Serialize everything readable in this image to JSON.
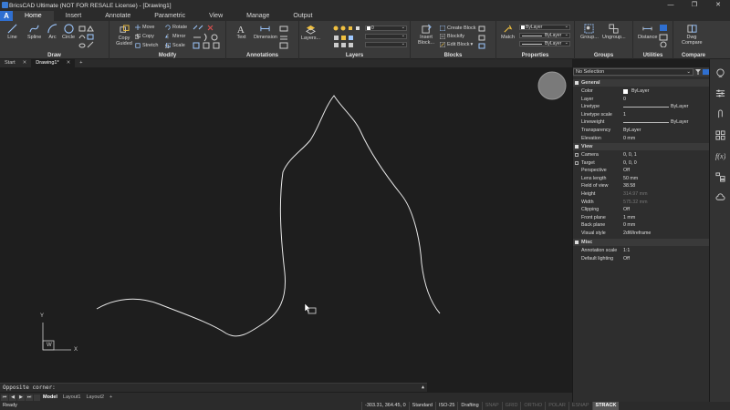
{
  "window": {
    "title": "BricsCAD Ultimate (NOT FOR RESALE License) - [Drawing1]",
    "minimize": "—",
    "restore": "❐",
    "close": "✕"
  },
  "ribbon_tabs": [
    "Home",
    "Insert",
    "Annotate",
    "Parametric",
    "View",
    "Manage",
    "Output"
  ],
  "app_logo": "A",
  "ribbon": {
    "draw": {
      "label": "Draw",
      "tools": [
        "Line",
        "Spline",
        "Arc",
        "Circle"
      ]
    },
    "modify": {
      "label": "Modify",
      "copy_guided": "Copy Guided",
      "move": "Move",
      "copy": "Copy",
      "stretch": "Stretch",
      "rotate": "Rotate",
      "mirror": "Mirror",
      "scale": "Scale"
    },
    "annotations": {
      "label": "Annotations",
      "text": "Text",
      "dimension": "Dimension"
    },
    "layers": {
      "label": "Layers",
      "layers_btn": "Layers...",
      "current_layer": "0"
    },
    "blocks": {
      "label": "Blocks",
      "insert_block": "Insert Block...",
      "create_block": "Create Block",
      "blockify": "Blockify",
      "edit_block": "Edit Block"
    },
    "properties": {
      "label": "Properties",
      "match": "Match",
      "color": "ByLayer",
      "linetype": "ByLayer",
      "lineweight": "ByLayer"
    },
    "groups": {
      "label": "Groups",
      "group": "Group...",
      "ungroup": "Ungroup..."
    },
    "utilities": {
      "label": "Utilities",
      "distance": "Distance"
    },
    "compare": {
      "label": "Compare",
      "dwg_compare": "Dwg Compare"
    }
  },
  "doc_tabs": [
    {
      "label": "Start",
      "close": "✕"
    },
    {
      "label": "Drawing1*",
      "close": "✕"
    }
  ],
  "new_tab": "+",
  "canvas": {
    "ucs_y": "Y",
    "ucs_x": "X",
    "ucs_w": "W"
  },
  "command_line": {
    "prompt": "Opposite corner:",
    "expand": "▲"
  },
  "layout_tabs": {
    "nav": [
      "⏮",
      "◀",
      "▶",
      "⏭"
    ],
    "tabs": [
      "Model",
      "Layout1",
      "Layout2"
    ],
    "add": "+"
  },
  "status_bar": {
    "ready": "Ready",
    "coords": "-303.31, 364.45, 0",
    "segments": [
      {
        "text": "Standard",
        "state": "normal"
      },
      {
        "text": "ISO-25",
        "state": "normal"
      },
      {
        "text": "Drafting",
        "state": "normal"
      },
      {
        "text": "SNAP",
        "state": "dim"
      },
      {
        "text": "GRID",
        "state": "dim"
      },
      {
        "text": "ORTHO",
        "state": "dim"
      },
      {
        "text": "POLAR",
        "state": "dim"
      },
      {
        "text": "ESNAP",
        "state": "dim"
      },
      {
        "text": "STRACK",
        "state": "on"
      }
    ]
  },
  "properties_panel": {
    "selection": "No Selection",
    "sections": {
      "general": "General",
      "view": "View",
      "misc": "Misc"
    },
    "general_rows": [
      {
        "key": "Color",
        "value": "ByLayer",
        "kind": "swatch"
      },
      {
        "key": "Layer",
        "value": "0",
        "kind": "text"
      },
      {
        "key": "Linetype",
        "value": "ByLayer",
        "kind": "line"
      },
      {
        "key": "Linetype scale",
        "value": "1",
        "kind": "text"
      },
      {
        "key": "Lineweight",
        "value": "ByLayer",
        "kind": "line"
      },
      {
        "key": "Transparency",
        "value": "ByLayer",
        "kind": "text"
      },
      {
        "key": "Elevation",
        "value": "0 mm",
        "kind": "text"
      }
    ],
    "view_rows": [
      {
        "key": "Camera",
        "value": "0, 0, 1",
        "kind": "expand"
      },
      {
        "key": "Target",
        "value": "0, 0, 0",
        "kind": "expand"
      },
      {
        "key": "Perspective",
        "value": "Off",
        "kind": "text"
      },
      {
        "key": "Lens length",
        "value": "50 mm",
        "kind": "text"
      },
      {
        "key": "Field of view",
        "value": "38.58",
        "kind": "text"
      },
      {
        "key": "Height",
        "value": "314.97 mm",
        "kind": "dim"
      },
      {
        "key": "Width",
        "value": "575.32 mm",
        "kind": "dim"
      },
      {
        "key": "Clipping",
        "value": "Off",
        "kind": "text"
      },
      {
        "key": "Front plane",
        "value": "1 mm",
        "kind": "text"
      },
      {
        "key": "Back plane",
        "value": "0 mm",
        "kind": "text"
      },
      {
        "key": "Visual style",
        "value": "2dWireframe",
        "kind": "text"
      }
    ],
    "misc_rows": [
      {
        "key": "Annotation scale",
        "value": "1:1",
        "kind": "text"
      },
      {
        "key": "Default lighting",
        "value": "Off",
        "kind": "text"
      }
    ]
  },
  "colors": {
    "accent": "#2f6fd0",
    "background": "#1e1e1e",
    "panel": "#2e2e2e",
    "ribbon": "#3a3a3a"
  }
}
